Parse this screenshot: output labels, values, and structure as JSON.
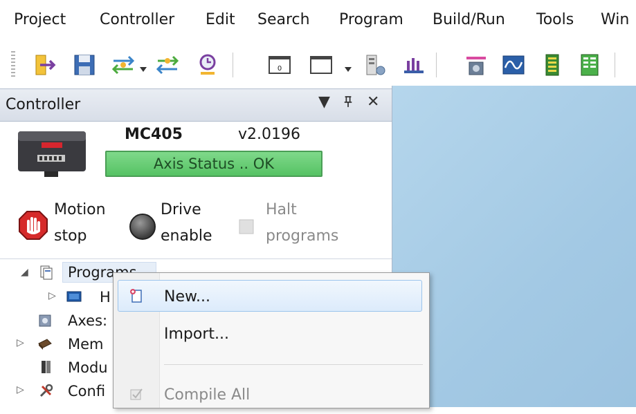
{
  "menubar": {
    "items": [
      "Project",
      "Controller",
      "Edit",
      "Search",
      "Program",
      "Build/Run",
      "Tools",
      "Win"
    ]
  },
  "toolbar": {
    "buttons": [
      "open-project",
      "save",
      "connect",
      "disconnect",
      "reconnect",
      "terminal",
      "window",
      "axis-parameters",
      "io-status",
      "oscilloscope",
      "table-viewer",
      "vr-viewer",
      "variable-viewer"
    ]
  },
  "panel": {
    "title": "Controller",
    "dropdown_glyph": "▼",
    "pin_glyph": "↕",
    "close_glyph": "✕",
    "controller_model": "MC405",
    "controller_version": "v2.0196",
    "axis_status": "Axis Status .. OK",
    "motion_stop": [
      "Motion",
      "stop"
    ],
    "drive_enable": [
      "Drive",
      "enable"
    ],
    "halt_programs": [
      "Halt",
      "programs"
    ]
  },
  "tree": {
    "items": [
      {
        "label": "Programs",
        "expander": "◢"
      },
      {
        "label": "H",
        "expander": "▷"
      },
      {
        "label": "Axes:",
        "expander": ""
      },
      {
        "label": "Mem",
        "expander": "▷"
      },
      {
        "label": "Modu",
        "expander": ""
      },
      {
        "label": "Confi",
        "expander": "▷"
      }
    ]
  },
  "context_menu": {
    "items": [
      {
        "label": "New...",
        "enabled": true
      },
      {
        "label": "Import...",
        "enabled": true
      },
      {
        "label": "Compile All",
        "enabled": false
      }
    ]
  },
  "colors": {
    "status_green": "#5cc66a",
    "workspace_blue": "#a8cde6",
    "highlight": "#dcebfb"
  }
}
